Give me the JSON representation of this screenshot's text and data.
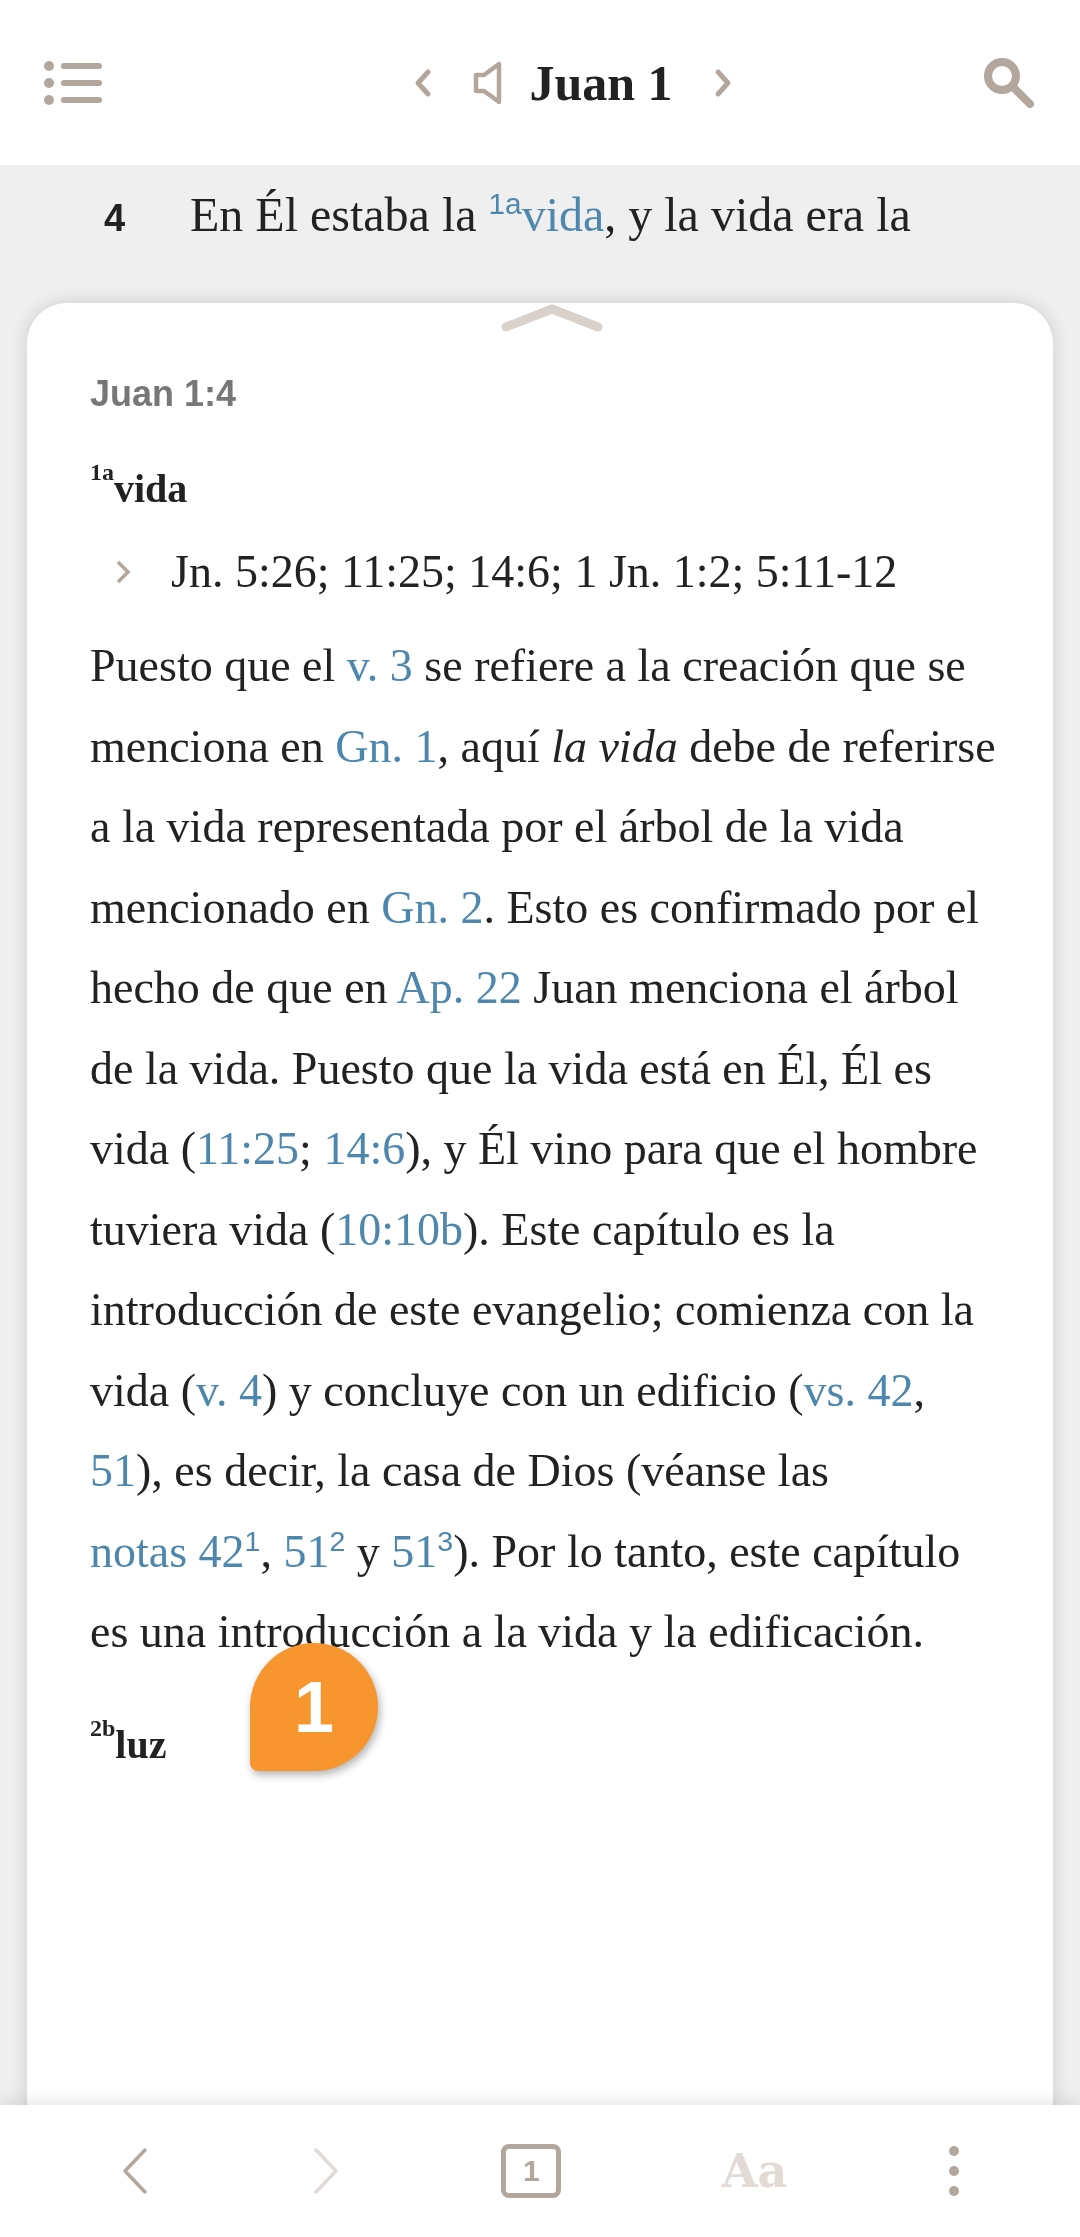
{
  "top_bar": {
    "title": "Juan 1"
  },
  "verse": {
    "number": "4",
    "segments": [
      {
        "kind": "plain",
        "text": "En Él estaba la "
      },
      {
        "kind": "link",
        "text": "$^{1a}$vida"
      },
      {
        "kind": "plain",
        "text": ", y la vida era la"
      }
    ]
  },
  "note_panel": {
    "reference": "Juan 1:4",
    "notes": [
      {
        "marker": "1a",
        "word": "vida",
        "cross_references": "Jn. 5:26; 11:25; 14:6; 1 Jn. 1:2; 5:11-12",
        "segments": [
          {
            "kind": "plain",
            "text": "Puesto que el "
          },
          {
            "kind": "link",
            "text": "v. 3"
          },
          {
            "kind": "plain",
            "text": " se refiere a la creación que se menciona en "
          },
          {
            "kind": "link",
            "text": "Gn. 1"
          },
          {
            "kind": "plain",
            "text": ", aquí *la vida* debe de referirse a la vida representada por el árbol de la vida mencionado en "
          },
          {
            "kind": "link",
            "text": "Gn. 2"
          },
          {
            "kind": "plain",
            "text": ". Esto es confirmado por el hecho de que en "
          },
          {
            "kind": "link",
            "text": "Ap. 22"
          },
          {
            "kind": "plain",
            "text": " Juan menciona el árbol de la vida. Puesto que la vida está en Él, Él es vida ("
          },
          {
            "kind": "link",
            "text": "11:25"
          },
          {
            "kind": "plain",
            "text": "; "
          },
          {
            "kind": "link",
            "text": "14:6"
          },
          {
            "kind": "plain",
            "text": "), y Él vino para que el hombre tuviera vida ("
          },
          {
            "kind": "link",
            "text": "10:10b"
          },
          {
            "kind": "plain",
            "text": "). Este capítulo es la introducción de este evangelio; comienza con la vida ("
          },
          {
            "kind": "link",
            "text": "v. 4"
          },
          {
            "kind": "plain",
            "text": ") y concluye con un edificio ("
          },
          {
            "kind": "link",
            "text": "vs. 42"
          },
          {
            "kind": "plain",
            "text": ", "
          },
          {
            "kind": "link",
            "text": "51"
          },
          {
            "kind": "plain",
            "text": "), es decir, la casa de Dios (véanse las "
          },
          {
            "kind": "link",
            "text": "notas 42$^{1}$"
          },
          {
            "kind": "plain",
            "text": ", "
          },
          {
            "kind": "link",
            "text": "51$^{2}$"
          },
          {
            "kind": "plain",
            "text": " y "
          },
          {
            "kind": "link",
            "text": "51$^{3}$"
          },
          {
            "kind": "plain",
            "text": "). Por lo tanto, este capítulo es una introducción a la vida y la edificación."
          }
        ]
      },
      {
        "marker": "2b",
        "word": "luz"
      }
    ]
  },
  "badge": {
    "text": "1"
  },
  "bottom_bar": {
    "back": {
      "disabled": false
    },
    "forward": {
      "disabled": true
    },
    "page_number": "1",
    "font_button": "Aa"
  }
}
